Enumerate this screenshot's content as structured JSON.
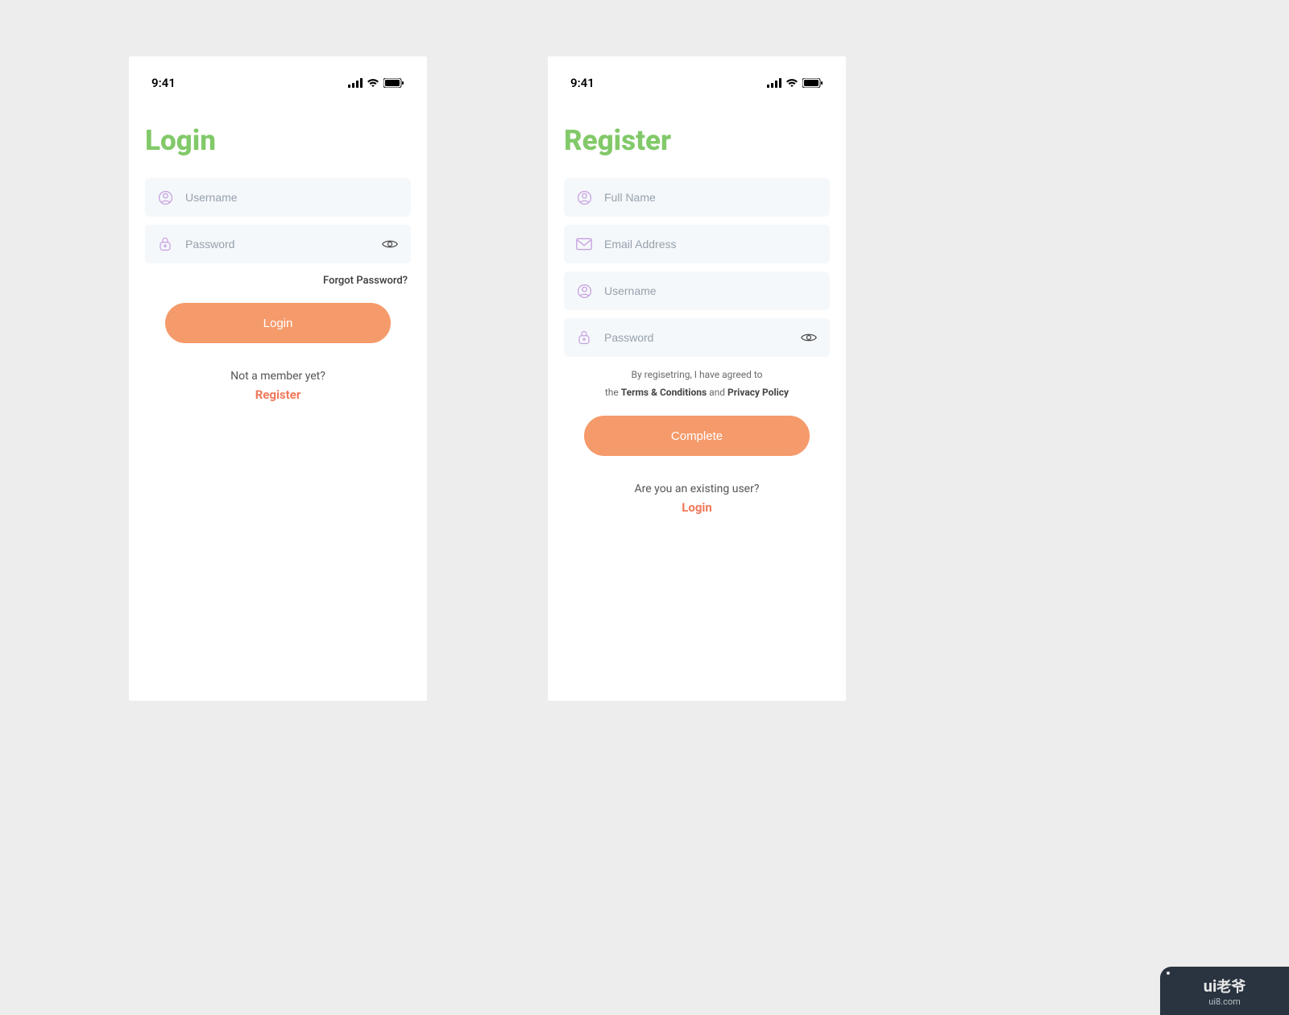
{
  "statusbar": {
    "time": "9:41"
  },
  "login": {
    "title": "Login",
    "username_placeholder": "Username",
    "password_placeholder": "Password",
    "forgot": "Forgot Password?",
    "button": "Login",
    "footer_question": "Not a member yet?",
    "footer_action": "Register"
  },
  "register": {
    "title": "Register",
    "fullname_placeholder": "Full Name",
    "email_placeholder": "Email Address",
    "username_placeholder": "Username",
    "password_placeholder": "Password",
    "terms_line1": "By regisetring, I have agreed to",
    "terms_the": "the",
    "terms_tc": "Terms & Conditions",
    "terms_and": "and",
    "terms_pp": "Privacy Policy",
    "button": "Complete",
    "footer_question": "Are you an existing user?",
    "footer_action": "Login"
  },
  "watermark": {
    "brand_en": "ui",
    "brand_cn": "老爷",
    "url": "ui8.com"
  },
  "colors": {
    "accent_green": "#82c969",
    "accent_orange": "#f59a6a",
    "accent_link": "#f0795a",
    "icon_purple": "#c79fe0",
    "input_bg": "#f4f8fb",
    "page_bg": "#ededed"
  }
}
